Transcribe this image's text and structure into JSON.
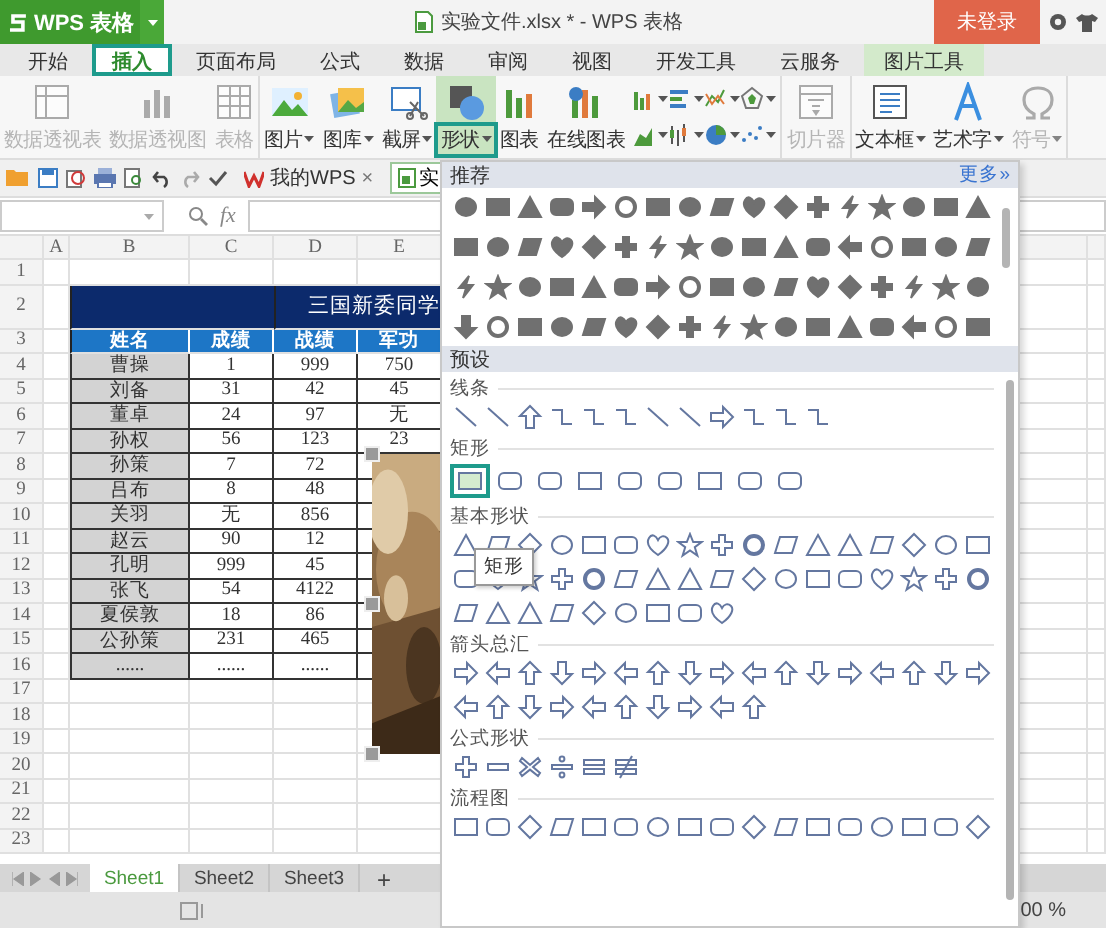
{
  "title_bar": {
    "app_button": "WPS 表格",
    "title": "实验文件.xlsx * - WPS 表格",
    "login_button": "未登录"
  },
  "tabs": [
    {
      "label": "开始",
      "selected": false,
      "kind": "normal"
    },
    {
      "label": "插入",
      "selected": true,
      "kind": "normal"
    },
    {
      "label": "页面布局",
      "selected": false,
      "kind": "normal"
    },
    {
      "label": "公式",
      "selected": false,
      "kind": "normal"
    },
    {
      "label": "数据",
      "selected": false,
      "kind": "normal"
    },
    {
      "label": "审阅",
      "selected": false,
      "kind": "normal"
    },
    {
      "label": "视图",
      "selected": false,
      "kind": "normal"
    },
    {
      "label": "开发工具",
      "selected": false,
      "kind": "normal"
    },
    {
      "label": "云服务",
      "selected": false,
      "kind": "normal"
    },
    {
      "label": "图片工具",
      "selected": false,
      "kind": "contextual"
    }
  ],
  "ribbon": {
    "groups": [
      {
        "items": [
          {
            "kind": "large",
            "label": "数据透视表",
            "caret": false,
            "disabled": true,
            "selected": false
          },
          {
            "kind": "large",
            "label": "数据透视图",
            "caret": false,
            "disabled": true,
            "selected": false
          },
          {
            "kind": "large",
            "label": "表格",
            "caret": false,
            "disabled": true,
            "selected": false
          }
        ]
      },
      {
        "items": [
          {
            "kind": "large",
            "label": "图片",
            "caret": true,
            "disabled": false,
            "selected": false
          },
          {
            "kind": "large",
            "label": "图库",
            "caret": true,
            "disabled": false,
            "selected": false
          },
          {
            "kind": "large",
            "label": "截屏",
            "caret": true,
            "disabled": false,
            "selected": false
          },
          {
            "kind": "large",
            "label": "形状",
            "caret": true,
            "disabled": false,
            "selected": true
          },
          {
            "kind": "large",
            "label": "图表",
            "caret": false,
            "disabled": false,
            "selected": false
          },
          {
            "kind": "large",
            "label": "在线图表",
            "caret": false,
            "disabled": false,
            "selected": false
          },
          {
            "kind": "chart-grid"
          }
        ]
      },
      {
        "items": [
          {
            "kind": "large",
            "label": "切片器",
            "caret": false,
            "disabled": true,
            "selected": false
          }
        ]
      },
      {
        "items": [
          {
            "kind": "large",
            "label": "文本框",
            "caret": true,
            "disabled": false,
            "selected": false
          },
          {
            "kind": "large",
            "label": "艺术字",
            "caret": true,
            "disabled": false,
            "selected": false
          },
          {
            "kind": "large",
            "label": "符号",
            "caret": true,
            "disabled": true,
            "selected": false
          }
        ]
      }
    ]
  },
  "quick_bar": {
    "my_wps_tab": "我的WPS",
    "close": "×",
    "doc_tab": "实"
  },
  "formula_bar": {
    "fx": "fx"
  },
  "sheet": {
    "columns": [
      "A",
      "B",
      "C",
      "D",
      "E"
    ],
    "rows": [
      {
        "number": "1",
        "kind": "empty",
        "cells": []
      },
      {
        "number": "2",
        "kind": "title",
        "cells": [
          "",
          "",
          "",
          "三国新委同学"
        ]
      },
      {
        "number": "3",
        "kind": "header",
        "cells": [
          "",
          "姓名",
          "成绩",
          "战绩",
          "军功"
        ]
      },
      {
        "number": "4",
        "kind": "data",
        "cells": [
          "",
          "曹操",
          "1",
          "999",
          "750"
        ]
      },
      {
        "number": "5",
        "kind": "data",
        "cells": [
          "",
          "刘备",
          "31",
          "42",
          "45"
        ]
      },
      {
        "number": "6",
        "kind": "data",
        "cells": [
          "",
          "董卓",
          "24",
          "97",
          "无"
        ]
      },
      {
        "number": "7",
        "kind": "data",
        "cells": [
          "",
          "孙权",
          "56",
          "123",
          "23"
        ]
      },
      {
        "number": "8",
        "kind": "data",
        "cells": [
          "",
          "孙策",
          "7",
          "72"
        ]
      },
      {
        "number": "9",
        "kind": "data",
        "cells": [
          "",
          "吕布",
          "8",
          "48"
        ]
      },
      {
        "number": "10",
        "kind": "data",
        "cells": [
          "",
          "关羽",
          "无",
          "856"
        ]
      },
      {
        "number": "11",
        "kind": "data",
        "cells": [
          "",
          "赵云",
          "90",
          "12"
        ]
      },
      {
        "number": "12",
        "kind": "data",
        "cells": [
          "",
          "孔明",
          "999",
          "45"
        ]
      },
      {
        "number": "13",
        "kind": "data",
        "cells": [
          "",
          "张飞",
          "54",
          "4122"
        ]
      },
      {
        "number": "14",
        "kind": "data",
        "cells": [
          "",
          "夏侯敦",
          "18",
          "86"
        ]
      },
      {
        "number": "15",
        "kind": "data",
        "cells": [
          "",
          "公孙策",
          "231",
          "465"
        ]
      },
      {
        "number": "16",
        "kind": "data",
        "cells": [
          "",
          "......",
          "......",
          "......"
        ]
      },
      {
        "number": "17",
        "kind": "empty",
        "cells": []
      },
      {
        "number": "18",
        "kind": "empty",
        "cells": []
      },
      {
        "number": "19",
        "kind": "empty",
        "cells": []
      },
      {
        "number": "20",
        "kind": "empty",
        "cells": []
      },
      {
        "number": "21",
        "kind": "empty",
        "cells": []
      },
      {
        "number": "22",
        "kind": "empty",
        "cells": []
      },
      {
        "number": "23",
        "kind": "empty",
        "cells": []
      }
    ]
  },
  "sheet_tabs": [
    {
      "label": "Sheet1",
      "selected": true
    },
    {
      "label": "Sheet2",
      "selected": false
    },
    {
      "label": "Sheet3",
      "selected": false
    }
  ],
  "add_sheet": "+",
  "status_bar": {
    "zoom": "00 %"
  },
  "shape_panel": {
    "recommended_title": "推荐",
    "more_link": "更多»",
    "presets_title": "预设",
    "sections": [
      {
        "title": "线条"
      },
      {
        "title": "矩形",
        "shapes": [
          {
            "selected": true
          },
          {
            "selected": false
          },
          {
            "selected": false
          },
          {
            "selected": false
          },
          {
            "selected": false
          },
          {
            "selected": false
          },
          {
            "selected": false
          },
          {
            "selected": false
          },
          {
            "selected": false
          }
        ]
      },
      {
        "title": "基本形状"
      },
      {
        "title": "箭头总汇"
      },
      {
        "title": "公式形状"
      },
      {
        "title": "流程图"
      }
    ],
    "tooltip": "矩形"
  }
}
